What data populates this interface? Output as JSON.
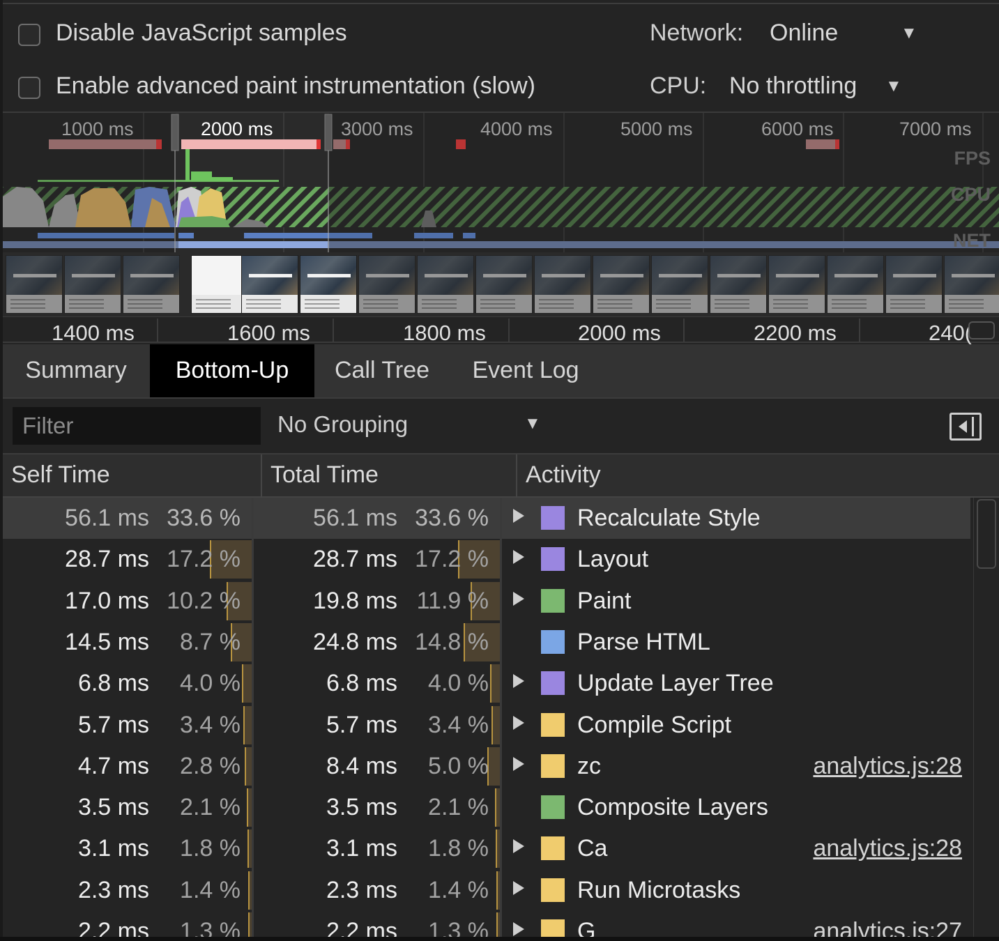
{
  "settings": {
    "disable_js_samples": {
      "label": "Disable JavaScript samples",
      "checked": false
    },
    "advanced_paint": {
      "label": "Enable advanced paint instrumentation (slow)",
      "checked": false
    },
    "network": {
      "label": "Network:",
      "value": "Online"
    },
    "cpu": {
      "label": "CPU:",
      "value": "No throttling"
    }
  },
  "overview": {
    "ruler_labels": [
      "1000 ms",
      "2000 ms",
      "3000 ms",
      "4000 ms",
      "5000 ms",
      "6000 ms",
      "7000 ms"
    ],
    "selected_label": "2000 ms",
    "tracks": {
      "fps": "FPS",
      "cpu": "CPU",
      "net": "NET"
    }
  },
  "detail_ruler": {
    "labels": [
      "1400 ms",
      "1600 ms",
      "1800 ms",
      "2000 ms",
      "2200 ms",
      "240("
    ]
  },
  "tabs": [
    {
      "label": "Summary",
      "active": false
    },
    {
      "label": "Bottom-Up",
      "active": true
    },
    {
      "label": "Call Tree",
      "active": false
    },
    {
      "label": "Event Log",
      "active": false
    }
  ],
  "toolbar": {
    "filter_placeholder": "Filter",
    "grouping": "No Grouping"
  },
  "table": {
    "columns": {
      "self": "Self Time",
      "total": "Total Time",
      "activity": "Activity"
    },
    "rows": [
      {
        "self_ms": "56.1 ms",
        "self_pct": "33.6 %",
        "total_ms": "56.1 ms",
        "total_pct": "33.6 %",
        "activity": "Recalculate Style",
        "category": "rendering",
        "expandable": true,
        "link": "",
        "self_frac": 0.336,
        "total_frac": 0.336,
        "selected": true
      },
      {
        "self_ms": "28.7 ms",
        "self_pct": "17.2 %",
        "total_ms": "28.7 ms",
        "total_pct": "17.2 %",
        "activity": "Layout",
        "category": "rendering",
        "expandable": true,
        "link": "",
        "self_frac": 0.172,
        "total_frac": 0.172
      },
      {
        "self_ms": "17.0 ms",
        "self_pct": "10.2 %",
        "total_ms": "19.8 ms",
        "total_pct": "11.9 %",
        "activity": "Paint",
        "category": "painting",
        "expandable": true,
        "link": "",
        "self_frac": 0.102,
        "total_frac": 0.119
      },
      {
        "self_ms": "14.5 ms",
        "self_pct": "8.7 %",
        "total_ms": "24.8 ms",
        "total_pct": "14.8 %",
        "activity": "Parse HTML",
        "category": "loading",
        "expandable": false,
        "link": "",
        "self_frac": 0.087,
        "total_frac": 0.148
      },
      {
        "self_ms": "6.8 ms",
        "self_pct": "4.0 %",
        "total_ms": "6.8 ms",
        "total_pct": "4.0 %",
        "activity": "Update Layer Tree",
        "category": "rendering",
        "expandable": true,
        "link": "",
        "self_frac": 0.04,
        "total_frac": 0.04
      },
      {
        "self_ms": "5.7 ms",
        "self_pct": "3.4 %",
        "total_ms": "5.7 ms",
        "total_pct": "3.4 %",
        "activity": "Compile Script",
        "category": "scripting",
        "expandable": true,
        "link": "",
        "self_frac": 0.034,
        "total_frac": 0.034
      },
      {
        "self_ms": "4.7 ms",
        "self_pct": "2.8 %",
        "total_ms": "8.4 ms",
        "total_pct": "5.0 %",
        "activity": "zc",
        "category": "scripting",
        "expandable": true,
        "link": "analytics.js:28",
        "self_frac": 0.028,
        "total_frac": 0.05
      },
      {
        "self_ms": "3.5 ms",
        "self_pct": "2.1 %",
        "total_ms": "3.5 ms",
        "total_pct": "2.1 %",
        "activity": "Composite Layers",
        "category": "painting",
        "expandable": false,
        "link": "",
        "self_frac": 0.021,
        "total_frac": 0.021
      },
      {
        "self_ms": "3.1 ms",
        "self_pct": "1.8 %",
        "total_ms": "3.1 ms",
        "total_pct": "1.8 %",
        "activity": "Ca",
        "category": "scripting",
        "expandable": true,
        "link": "analytics.js:28",
        "self_frac": 0.018,
        "total_frac": 0.018
      },
      {
        "self_ms": "2.3 ms",
        "self_pct": "1.4 %",
        "total_ms": "2.3 ms",
        "total_pct": "1.4 %",
        "activity": "Run Microtasks",
        "category": "scripting",
        "expandable": true,
        "link": "",
        "self_frac": 0.014,
        "total_frac": 0.014
      },
      {
        "self_ms": "2.2 ms",
        "self_pct": "1.3 %",
        "total_ms": "2.2 ms",
        "total_pct": "1.3 %",
        "activity": "G",
        "category": "scripting",
        "expandable": true,
        "link": "analytics.js:27",
        "self_frac": 0.013,
        "total_frac": 0.013
      }
    ]
  },
  "colors": {
    "rendering": "#9a86e0",
    "painting": "#7cb870",
    "loading": "#7ba6e5",
    "scripting": "#f0cc6e",
    "pct_bar": "#4d4230",
    "pct_bar_edge": "#b89440",
    "selection": "#3c3c3c"
  },
  "icons": {
    "dropdown": "triangle-down-icon",
    "expander": "triangle-right-icon",
    "sidebar": "sidebar-toggle-icon"
  }
}
